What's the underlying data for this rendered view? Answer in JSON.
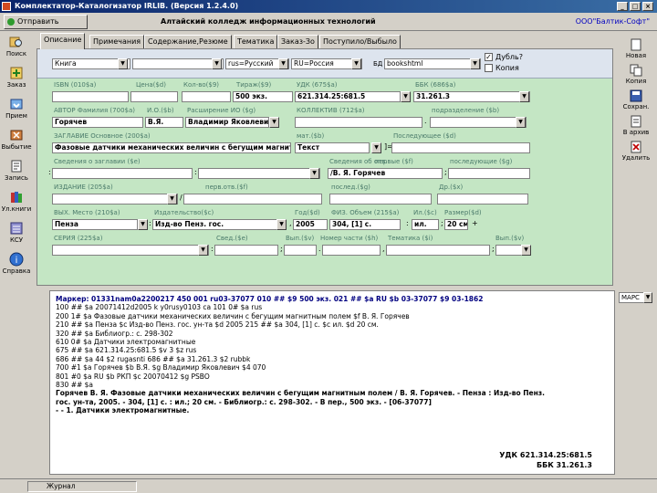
{
  "window": {
    "title": "Комплектатор-Каталогизатор IRLIB. (Версия 1.2.4.0)",
    "controls": [
      "_",
      "□",
      "×"
    ]
  },
  "header": {
    "open_button": "Отправить",
    "college": "Алтайский колледж информационных технологий",
    "vendor": "ООО\"Балтик-Софт\""
  },
  "left_toolbar": [
    {
      "label": "Поиск",
      "icon": "search-icon"
    },
    {
      "label": "Заказ",
      "icon": "order-icon"
    },
    {
      "label": "Прием",
      "icon": "receive-icon"
    },
    {
      "label": "Выбытие",
      "icon": "dispose-icon"
    },
    {
      "label": "Запись",
      "icon": "record-icon"
    },
    {
      "label": "Ул.книги",
      "icon": "books-icon"
    },
    {
      "label": "КСУ",
      "icon": "ksu-icon"
    },
    {
      "label": "Справка",
      "icon": "help-icon"
    }
  ],
  "tabs": [
    "Описание",
    "Примечания",
    "Содержание,Резюме",
    "Тематика",
    "Заказ-Зо",
    "Поступило/Выбыло"
  ],
  "top_row": {
    "doc_type": "Книга",
    "type2": "",
    "language": "rus=Русский",
    "country": "RU=Россия",
    "rec_code_label": "БД",
    "rec_code": "bookshtml",
    "dup_label": "Дубль?",
    "copy_label": "Копия"
  },
  "labels": {
    "isbn": "ISBN (010$a)",
    "price": "Цена($d)",
    "qty": "Кол-во($9)",
    "circ": "Тираж($9)",
    "udk": "УДК (675$a)",
    "bbk": "ББК (686$a)",
    "author": "АВТОР Фамилия (700$a)",
    "init": "И.О.($b)",
    "full_name": "Расширение ИО ($g)",
    "collective": "КОЛЛЕКТИВ (712$a)",
    "subdiv": "подразделение ($b)",
    "title": "ЗАГЛАВИЕ Основное (200$a)",
    "gmd": "мат.($b)",
    "pref": "Последующее ($d)",
    "other_title": "Сведения о заглавии ($e)",
    "resp": "Сведения об отв.",
    "resp_f": "первые ($f)",
    "resp_g": "последующие ($g)",
    "edition": "ИЗДАНИЕ (205$a)",
    "ed_f": "перв.отв.($f)",
    "ed_g": "послед.($g)",
    "ed_x": "Др.($x)",
    "pub_place": "ВЫХ. Место (210$a)",
    "publisher": "Издательство($c)",
    "year": "Год($d)",
    "pages": "ФИЗ. Объем (215$a)",
    "ill": "Ил.($c)",
    "size": "Размер($d)",
    "series": "СЕРИЯ (225$a)",
    "series_h": "Свед.($e)",
    "series_v": "Вып.($v)",
    "series_i": "Тематика ($i)",
    "series_num": "Номер части ($h)",
    "series_end": "Вып.($v)"
  },
  "fields": {
    "isbn": "",
    "price": "",
    "qty": "500 экз.",
    "udk": "621.314.25:681.5",
    "bbk": "31.261.3",
    "author": "Горячев",
    "init": "В.Я.",
    "full_name": "Владимир Яковлевич",
    "title": "Фазовые датчики механических величин с бегущим магнитным полем",
    "gmd": "Текст",
    "resp": "/В. Я. Горячев",
    "pub_place": "Пенза",
    "publisher": "Изд-во Пенз. гос.",
    "year": "2005",
    "pages": "304, [1] с.",
    "ill": "ил.",
    "size": "20 см."
  },
  "right_toolbar": [
    {
      "label": "Новая",
      "icon": "new-icon"
    },
    {
      "label": "Копия",
      "icon": "copy-icon"
    },
    {
      "label": "Сохран.",
      "icon": "save-icon"
    },
    {
      "label": "В архив",
      "icon": "archive-icon"
    },
    {
      "label": "Удалить",
      "icon": "delete-icon"
    }
  ],
  "record": {
    "lines": [
      "Маркер: 01331nam0a2200217 450  001 ru03-37077  010 ## $9 500 экз.  021 ## $a RU $b 03-37077 $9 03-1862",
      "100 ## $a 20071412d2005 k  y0rusy0103  ca  101 0# $a rus",
      "200 1# $a Фазовые датчики механических величин с бегущим магнитным полем $f В. Я. Горячев",
      "210 ## $a Пенза $c Изд-во Пенз. гос. ун-та $d 2005  215 ## $a 304, [1] с. $c ил. $d 20 см.",
      "320 ## $a Библиогр.: с. 298-302",
      "610 0# $a Датчики электромагнитные",
      "675 ## $a 621.314.25:681.5 $v 3 $z rus",
      "686 ## $a 44 $2 rugasnti  686 ## $a 31.261.3 $2 rubbk",
      "700 #1 $a Горячев $b В.Я. $g Владимир Яковлевич $4 070",
      "801 #0 $a RU $b РКП $c 20070412 $g PSBO",
      "830 ## $a"
    ],
    "body": [
      "  Горячев В. Я. Фазовые датчики механических величин с бегущим магнитным полем / В. Я. Горячев. - Пенза : Изд-во Пенз.",
      "гос. ун-та, 2005. - 304, [1] с. : ил.; 20 см. - Библиогр.: с. 298-302. - В пер., 500 экз. - [06-37077]",
      "  - - 1. Датчики электромагнитные."
    ],
    "udk": "УДК 621.314.25:681.5",
    "bbk": "ББК 31.261.3"
  },
  "mark_select": "МАРС",
  "status": {
    "journal": "Журнал"
  }
}
